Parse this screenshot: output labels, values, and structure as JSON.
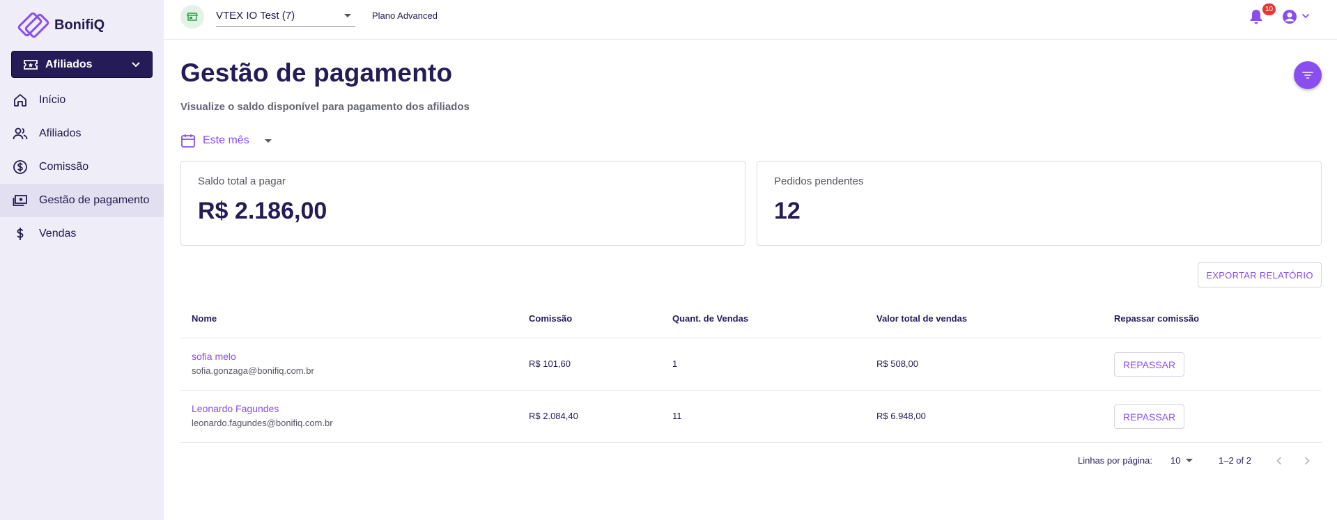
{
  "app": {
    "brand": "BonifiQ"
  },
  "sidebar": {
    "module": "Afiliados",
    "items": [
      {
        "label": "Início",
        "icon": "home-icon"
      },
      {
        "label": "Afiliados",
        "icon": "users-icon"
      },
      {
        "label": "Comissão",
        "icon": "dollar-circle-icon"
      },
      {
        "label": "Gestão de pagamento",
        "icon": "payments-icon",
        "active": true
      },
      {
        "label": "Vendas",
        "icon": "dollar-icon"
      }
    ]
  },
  "topbar": {
    "store": "VTEX IO Test (7)",
    "plan": "Plano Advanced",
    "notifications": "10"
  },
  "main": {
    "title": "Gestão de pagamento",
    "subtitle": "Visualize o saldo disponível para pagamento dos afiliados",
    "period": "Este mês",
    "cards": [
      {
        "label": "Saldo total a pagar",
        "value": "R$ 2.186,00"
      },
      {
        "label": "Pedidos pendentes",
        "value": "12"
      }
    ],
    "export_label": "EXPORTAR RELATÓRIO"
  },
  "table": {
    "headers": [
      "Nome",
      "Comissão",
      "Quant. de Vendas",
      "Valor total de vendas",
      "Repassar comissão"
    ],
    "rows": [
      {
        "name": "sofia melo",
        "email": "sofia.gonzaga@bonifiq.com.br",
        "commission": "R$ 101,60",
        "sales": "1",
        "total": "R$ 508,00",
        "action": "REPASSAR"
      },
      {
        "name": "Leonardo Fagundes",
        "email": "leonardo.fagundes@bonifiq.com.br",
        "commission": "R$ 2.084,40",
        "sales": "11",
        "total": "R$ 6.948,00",
        "action": "REPASSAR"
      }
    ]
  },
  "pagination": {
    "rows_label": "Linhas por página:",
    "rows_value": "10",
    "range": "1–2 of 2"
  },
  "colors": {
    "accent": "#8a4df0",
    "primary_dark": "#241b57",
    "sidebar_bg": "#efedf8",
    "badge": "#e53935"
  }
}
